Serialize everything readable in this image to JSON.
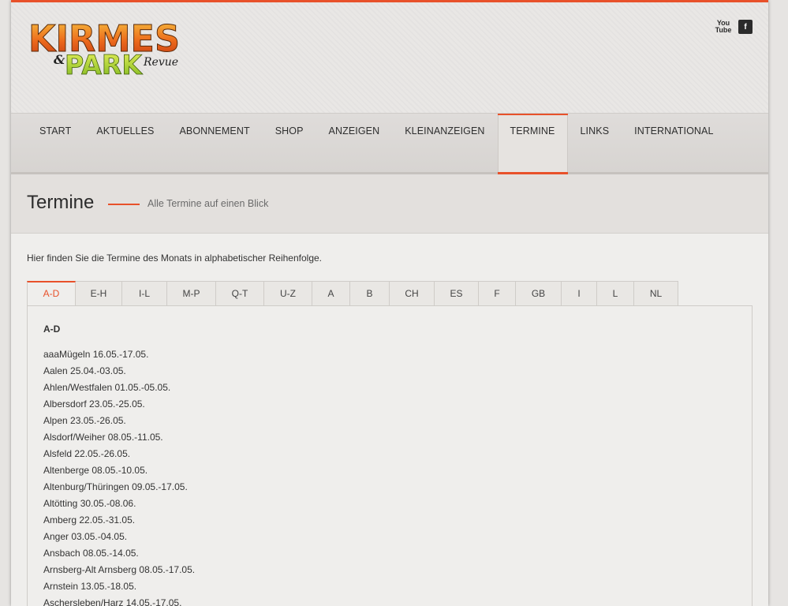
{
  "header": {
    "logo_top": "KIRMES",
    "logo_amp": "&",
    "logo_bottom": "PARK",
    "logo_script": "Revue",
    "social": [
      {
        "icon": "youtube-icon",
        "label": "You Tube"
      },
      {
        "icon": "facebook-icon",
        "label": "f"
      }
    ]
  },
  "nav": {
    "items": [
      "START",
      "AKTUELLES",
      "ABONNEMENT",
      "SHOP",
      "ANZEIGEN",
      "KLEINANZEIGEN",
      "TERMINE",
      "LINKS",
      "INTERNATIONAL"
    ],
    "active": "TERMINE"
  },
  "title": {
    "heading": "Termine",
    "subtitle": "Alle Termine auf einen Blick"
  },
  "intro": "Hier finden Sie die Termine des Monats in alphabetischer Reihenfolge.",
  "tabs": [
    "A-D",
    "E-H",
    "I-L",
    "M-P",
    "Q-T",
    "U-Z",
    "A",
    "B",
    "CH",
    "ES",
    "F",
    "GB",
    "I",
    "L",
    "NL"
  ],
  "active_tab": "A-D",
  "panel": {
    "heading": "A-D",
    "entries": [
      "aaaMügeln 16.05.-17.05.",
      "Aalen 25.04.-03.05.",
      "Ahlen/Westfalen 01.05.-05.05.",
      "Albersdorf 23.05.-25.05.",
      "Alpen 23.05.-26.05.",
      "Alsdorf/Weiher 08.05.-11.05.",
      "Alsfeld 22.05.-26.05.",
      "Altenberge 08.05.-10.05.",
      "Altenburg/Thüringen 09.05.-17.05.",
      "Altötting 30.05.-08.06.",
      "Amberg 22.05.-31.05.",
      "Anger 03.05.-04.05.",
      "Ansbach 08.05.-14.05.",
      "Arnsberg-Alt Arnsberg 08.05.-17.05.",
      "Arnstein 13.05.-18.05.",
      "Aschersleben/Harz 14.05.-17.05."
    ]
  },
  "colors": {
    "accent": "#e8512a",
    "background": "#efeeec"
  }
}
